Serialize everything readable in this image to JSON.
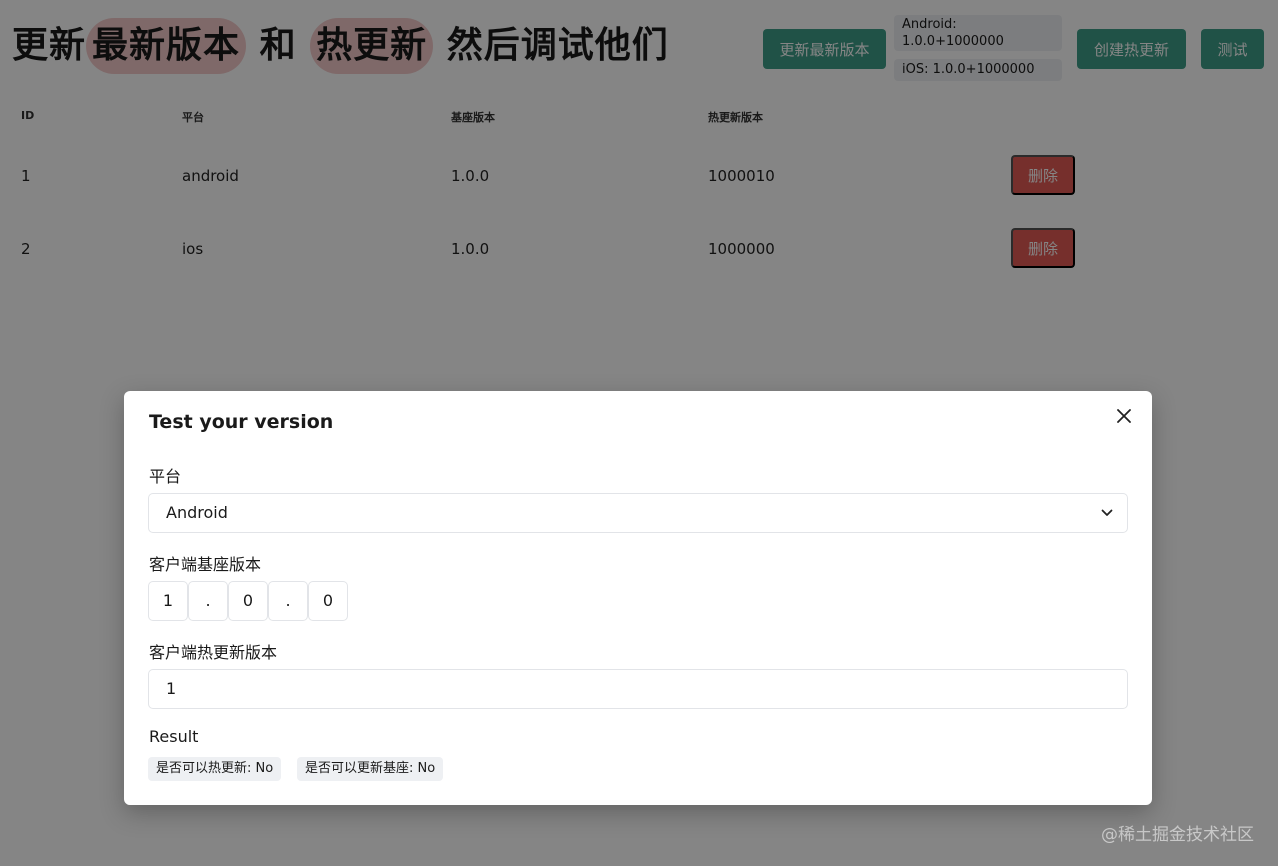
{
  "header": {
    "title_part1": "更新",
    "title_highlight1": "最新版本",
    "title_part2": "和",
    "title_highlight2": "热更新",
    "title_part3": "然后调试他们",
    "update_latest_label": "更新最新版本",
    "android_version": "Android: 1.0.0+1000000",
    "ios_version": "iOS: 1.0.0+1000000",
    "create_hot_update_label": "创建热更新",
    "test_label": "测试"
  },
  "table": {
    "headers": [
      "ID",
      "平台",
      "基座版本",
      "热更新版本"
    ],
    "rows": [
      {
        "id": "1",
        "platform": "android",
        "base": "1.0.0",
        "hot": "1000010",
        "delete_label": "删除"
      },
      {
        "id": "2",
        "platform": "ios",
        "base": "1.0.0",
        "hot": "1000000",
        "delete_label": "删除"
      }
    ]
  },
  "modal": {
    "title": "Test your version",
    "platform_label": "平台",
    "platform_value": "Android",
    "base_label": "客户端基座版本",
    "base_major": "1",
    "sep": ".",
    "base_minor": "0",
    "base_patch": "0",
    "hot_label": "客户端热更新版本",
    "hot_value": "1",
    "result_label": "Result",
    "can_hot_update": "是否可以热更新: No",
    "can_update_base": "是否可以更新基座: No"
  },
  "watermark": "@稀土掘金技术社区",
  "colors": {
    "primary": "#3f9d88",
    "danger": "#e25a55",
    "highlight": "#f3caca",
    "tag_bg": "#eef0f3"
  }
}
